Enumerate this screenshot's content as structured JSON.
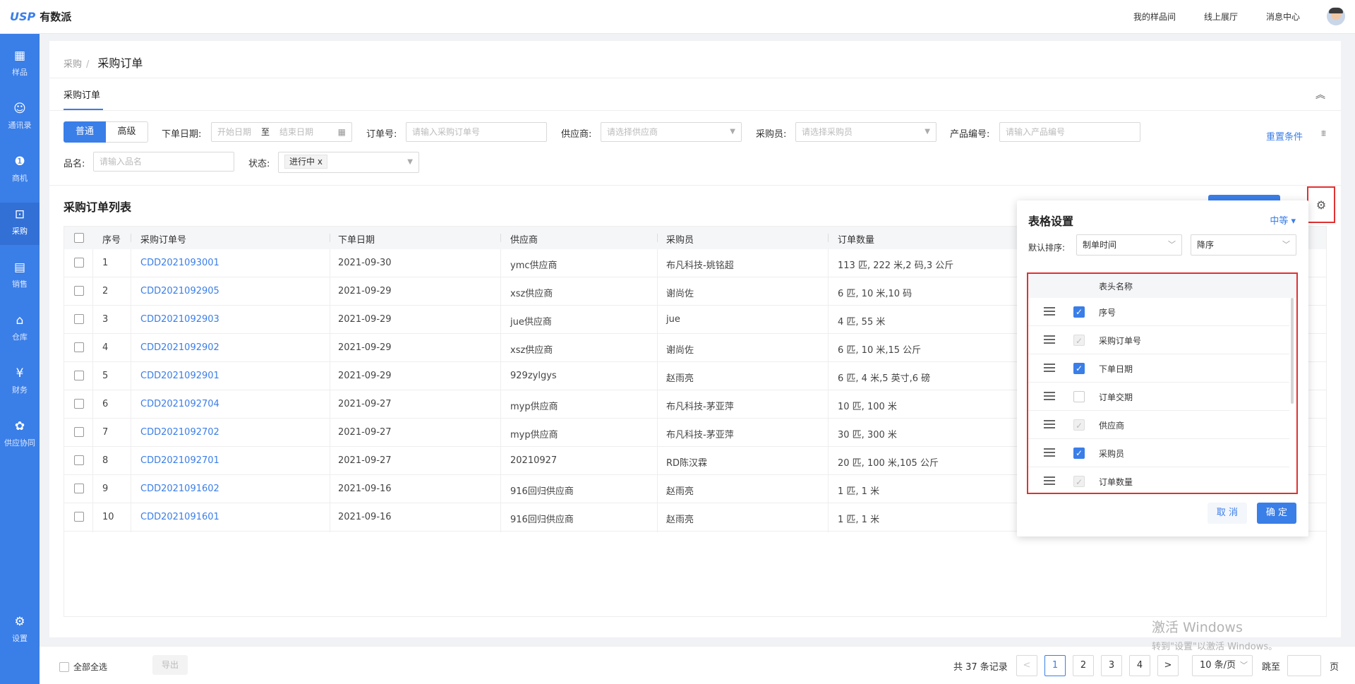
{
  "brand": {
    "mark": "USP",
    "name": "有数派"
  },
  "topnav": [
    "我的样品间",
    "线上展厅",
    "消息中心"
  ],
  "sidebar": [
    {
      "label": "样品",
      "icon": "sample-icon",
      "glyph": "▦"
    },
    {
      "label": "通讯录",
      "icon": "contacts-icon",
      "glyph": "☺"
    },
    {
      "label": "商机",
      "icon": "opportunity-icon",
      "glyph": "❶"
    },
    {
      "label": "采购",
      "icon": "purchase-icon",
      "glyph": "⊡"
    },
    {
      "label": "销售",
      "icon": "sales-icon",
      "glyph": "▤"
    },
    {
      "label": "仓库",
      "icon": "warehouse-icon",
      "glyph": "⌂"
    },
    {
      "label": "财务",
      "icon": "finance-icon",
      "glyph": "¥"
    },
    {
      "label": "供应协同",
      "icon": "supply-icon",
      "glyph": "✿"
    },
    {
      "label": "设置",
      "icon": "settings-icon",
      "glyph": "⚙"
    }
  ],
  "breadcrumb": {
    "parent": "采购",
    "sep": "/",
    "current": "采购订单"
  },
  "tab": "采购订单",
  "filters": {
    "mode_normal": "普通",
    "mode_advanced": "高级",
    "date_label": "下单日期:",
    "date_start": "开始日期",
    "date_to": "至",
    "date_end": "结束日期",
    "order_label": "订单号:",
    "order_placeholder": "请输入采购订单号",
    "supplier_label": "供应商:",
    "supplier_placeholder": "请选择供应商",
    "buyer_label": "采购员:",
    "buyer_placeholder": "请选择采购员",
    "product_label": "产品编号:",
    "product_placeholder": "请输入产品编号",
    "name_label": "品名:",
    "name_placeholder": "请输入品名",
    "status_label": "状态:",
    "status_tag": "进行中 x",
    "reset": "重置条件"
  },
  "list_title": "采购订单列表",
  "table": {
    "headers": [
      "序号",
      "采购订单号",
      "下单日期",
      "供应商",
      "采购员",
      "订单数量"
    ],
    "rows": [
      [
        "1",
        "CDD2021093001",
        "2021-09-30",
        "ymc供应商",
        "布凡科技-姚铭超",
        "113 匹, 222 米,2 码,3 公斤"
      ],
      [
        "2",
        "CDD2021092905",
        "2021-09-29",
        "xsz供应商",
        "谢尚佐",
        "6 匹, 10 米,10 码"
      ],
      [
        "3",
        "CDD2021092903",
        "2021-09-29",
        "jue供应商",
        "jue",
        "4 匹, 55 米"
      ],
      [
        "4",
        "CDD2021092902",
        "2021-09-29",
        "xsz供应商",
        "谢尚佐",
        "6 匹, 10 米,15 公斤"
      ],
      [
        "5",
        "CDD2021092901",
        "2021-09-29",
        "929zylgys",
        "赵雨亮",
        "6 匹, 4 米,5 英寸,6 磅"
      ],
      [
        "6",
        "CDD2021092704",
        "2021-09-27",
        "myp供应商",
        "布凡科技-茅亚萍",
        "10 匹, 100 米"
      ],
      [
        "7",
        "CDD2021092702",
        "2021-09-27",
        "myp供应商",
        "布凡科技-茅亚萍",
        "30 匹, 300 米"
      ],
      [
        "8",
        "CDD2021092701",
        "2021-09-27",
        "20210927",
        "RD陈汉霖",
        "20 匹, 100 米,105 公斤"
      ],
      [
        "9",
        "CDD2021091602",
        "2021-09-16",
        "916回归供应商",
        "赵雨亮",
        "1 匹, 1 米"
      ],
      [
        "10",
        "CDD2021091601",
        "2021-09-16",
        "916回归供应商",
        "赵雨亮",
        "1 匹, 1 米"
      ]
    ]
  },
  "popup": {
    "title": "表格设置",
    "density": "中等 ▾",
    "sort_label": "默认排序:",
    "sort_field": "制单时间",
    "sort_order": "降序",
    "col_header": "表头名称",
    "columns": [
      {
        "label": "序号",
        "state": "on"
      },
      {
        "label": "采购订单号",
        "state": "dis"
      },
      {
        "label": "下单日期",
        "state": "on"
      },
      {
        "label": "订单交期",
        "state": "off"
      },
      {
        "label": "供应商",
        "state": "dis"
      },
      {
        "label": "采购员",
        "state": "on"
      },
      {
        "label": "订单数量",
        "state": "dis"
      }
    ],
    "cancel": "取 消",
    "ok": "确 定"
  },
  "footer": {
    "select_all": "全部全选",
    "export": "导出",
    "total": "共 37 条记录",
    "pages": [
      "1",
      "2",
      "3",
      "4"
    ],
    "prev": "<",
    "next": ">",
    "page_size": "10 条/页",
    "jump": "跳至",
    "page_unit": "页"
  },
  "watermark": {
    "line1": "激活 Windows",
    "line2": "转到\"设置\"以激活 Windows。"
  },
  "colors": {
    "accent": "#3a7ee8",
    "highlight": "#e03131"
  }
}
